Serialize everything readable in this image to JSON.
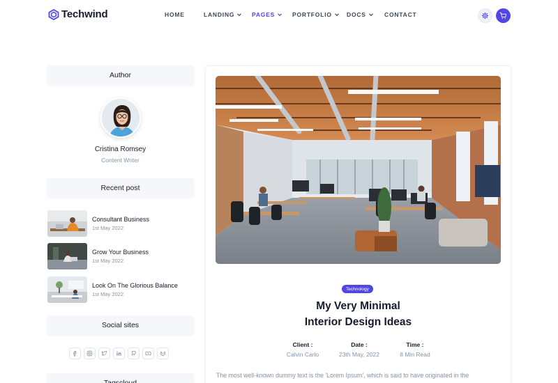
{
  "brand": {
    "name": "Techwind",
    "accent": "#4f46e5"
  },
  "nav": {
    "items": [
      {
        "label": "HOME",
        "has_dropdown": false,
        "active": false
      },
      {
        "label": "LANDING",
        "has_dropdown": true,
        "active": false
      },
      {
        "label": "PAGES",
        "has_dropdown": true,
        "active": true
      },
      {
        "label": "PORTFOLIO",
        "has_dropdown": true,
        "active": false
      },
      {
        "label": "DOCS",
        "has_dropdown": true,
        "active": false
      },
      {
        "label": "CONTACT",
        "has_dropdown": false,
        "active": false
      }
    ],
    "settings_icon": "gear-icon",
    "cart_icon": "cart-icon"
  },
  "sidebar": {
    "author_heading": "Author",
    "author": {
      "name": "Cristina Romsey",
      "role": "Content Writer"
    },
    "recent_heading": "Recent post",
    "recent_posts": [
      {
        "title": "Consultant Business",
        "date": "1st May 2022"
      },
      {
        "title": "Grow Your Business",
        "date": "1st May 2022"
      },
      {
        "title": "Look On The Glorious Balance",
        "date": "1st May 2022"
      }
    ],
    "social_heading": "Social sites",
    "social_icons": [
      "facebook-icon",
      "instagram-icon",
      "twitter-icon",
      "linkedin-icon",
      "github-icon",
      "youtube-icon",
      "gitlab-icon"
    ],
    "tags_heading": "Tagscloud"
  },
  "article": {
    "tag": "Technology",
    "title_line1": "My Very Minimal",
    "title_line2": "Interior Design Ideas",
    "meta": [
      {
        "label": "Client :",
        "value": "Calvin Carlo"
      },
      {
        "label": "Date :",
        "value": "23th May, 2022"
      },
      {
        "label": "Time :",
        "value": "8 Min Read"
      }
    ],
    "excerpt": "The most well-known dummy text is the 'Lorem Ipsum', which is said to have originated in the"
  }
}
